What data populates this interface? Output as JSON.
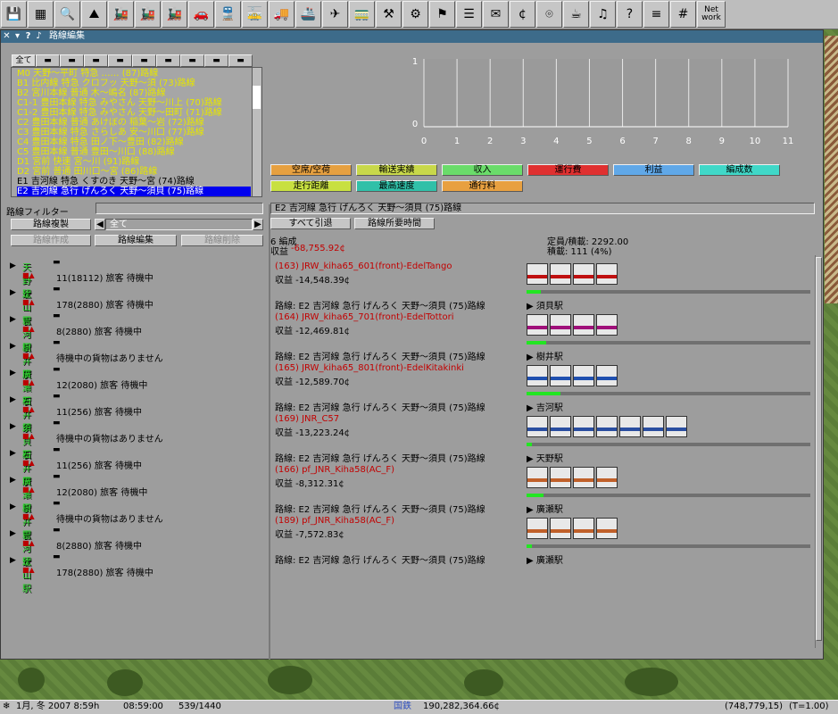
{
  "toolbar": {
    "icons": [
      "save-icon",
      "map-icon",
      "zoom-icon",
      "terrain-icon",
      "steam-loco-icon",
      "steam-loco-icon",
      "steam-loco-icon",
      "car-icon",
      "train-icon",
      "tram-icon",
      "truck-icon",
      "ship-icon",
      "plane-icon",
      "loco-icon",
      "crane-icon",
      "tools-icon",
      "signal-icon",
      "list-icon",
      "mailbox-icon",
      "money-icon",
      "camera-icon",
      "cup-icon",
      "music-icon",
      "help-icon",
      "rail-icon",
      "grid-icon"
    ],
    "network_label_1": "Net",
    "network_label_2": "work"
  },
  "window": {
    "title": "路線編集",
    "close": "✕",
    "menu": "▾",
    "help": "?",
    "pin": "♪"
  },
  "tabs": [
    "全て",
    "",
    "",
    "",
    "",
    "",
    "",
    "",
    "",
    ""
  ],
  "lines": [
    {
      "text": "M0  天野～平町  特急  ……  (87)路線",
      "style": "y"
    },
    {
      "text": "B1  比内線  特急  クロフッ  天野～須  (73)路線",
      "style": "y"
    },
    {
      "text": "B2  宮川本線  普通  木～嶋名  (87)路線",
      "style": "y"
    },
    {
      "text": "C1-1  豊田本線  特急  みやさん  天野～川上  (70)路線",
      "style": "y"
    },
    {
      "text": "C1-2  豊田本線  特急  みやさん  天野～田町  (71)路線",
      "style": "y"
    },
    {
      "text": "C2  豊田本線  普通  あけぼの  稲葉～岩  (72)路線",
      "style": "y"
    },
    {
      "text": "C3  豊田本線  特急  さらしあ  安～川口  (77)路線",
      "style": "y"
    },
    {
      "text": "C4  豊田本線  特急  田ノ下～豊田  (82)路線",
      "style": "y"
    },
    {
      "text": "C5  豊田本線  普通  豊田～川口  (88)路線",
      "style": "y"
    },
    {
      "text": "D1  宮前  快速  宮～川  (91)路線",
      "style": "y"
    },
    {
      "text": "D2  宮前  普通  田川口～宮  (86)路線",
      "style": "y"
    },
    {
      "text": "E1  吉河線  特急  くすのき  天野～宮  (74)路線",
      "style": "bl"
    },
    {
      "text": "E2  吉河線  急行  げんろく  天野～須貝  (75)路線",
      "style": "sel"
    }
  ],
  "filter": {
    "label": "路線フィルター",
    "copy_button": "路線複製",
    "filter_value": "全て",
    "create_button": "路線作成",
    "edit_button": "路線編集",
    "delete_button": "路線削除"
  },
  "stations": [
    {
      "name": "天野駅",
      "info": "11(18112) 旅客 待機中"
    },
    {
      "name": "辻山駅",
      "info": "178(2880) 旅客 待機中"
    },
    {
      "name": "吉河駅",
      "info": "8(2880) 旅客 待機中"
    },
    {
      "name": "樹井駅",
      "info": "待機中の貨物はありません"
    },
    {
      "name": "廣瀬駅",
      "info": "12(2080) 旅客 待機中"
    },
    {
      "name": "石井駅",
      "info": "11(256) 旅客 待機中"
    },
    {
      "name": "須貝駅",
      "info": "待機中の貨物はありません"
    },
    {
      "name": "石井駅",
      "info": "11(256) 旅客 待機中"
    },
    {
      "name": "廣瀬駅",
      "info": "12(2080) 旅客 待機中"
    },
    {
      "name": "樹井駅",
      "info": "待機中の貨物はありません"
    },
    {
      "name": "吉河駅",
      "info": "8(2880) 旅客 待機中"
    },
    {
      "name": "辻山駅",
      "info": "178(2880) 旅客 待機中"
    }
  ],
  "chart_data": {
    "type": "line",
    "x": [
      0,
      1,
      2,
      3,
      4,
      5,
      6,
      7,
      8,
      9,
      10,
      11
    ],
    "ylim": [
      0,
      1
    ],
    "y_ticks": [
      "0",
      "1"
    ],
    "grid": true,
    "series": []
  },
  "chart_buttons": [
    {
      "label": "空席/空荷",
      "color": "#e6a040"
    },
    {
      "label": "輸送実績",
      "color": "#c8d84a"
    },
    {
      "label": "収入",
      "color": "#6adc6a"
    },
    {
      "label": "運行費",
      "color": "#e03030"
    },
    {
      "label": "利益",
      "color": "#60a8e8"
    },
    {
      "label": "編成数",
      "color": "#40d8c8"
    },
    {
      "label": "走行距離",
      "color": "#c8e040"
    },
    {
      "label": "最高速度",
      "color": "#30c0a8"
    },
    {
      "label": "通行料",
      "color": "#e8a040"
    }
  ],
  "selected_line": {
    "name": "E2  吉河線  急行  げんろく  天野～須貝  (75)路線",
    "withdraw_button": "すべて引退",
    "time_button": "路線所要時間",
    "convoy_count": "6 編成",
    "income_label": "収益",
    "income": "-68,755.92¢",
    "capacity": "定員/積載: 2292.00",
    "load": "積載: 111 (4%)"
  },
  "convoys": [
    {
      "name": "(163) JRW_kiha65_601(front)-EdelTango",
      "income": "収益 -14,548.39¢",
      "route": "路線: E2  吉河線  急行  げんろく  天野～須貝  (75)路線",
      "dest": "須貝駅",
      "fill": 0.05,
      "livery": "#c01010"
    },
    {
      "name": "(164) JRW_kiha65_701(front)-EdelTottori",
      "income": "収益 -12,469.81¢",
      "route": "路線: E2  吉河線  急行  げんろく  天野～須貝  (75)路線",
      "dest": "樹井駅",
      "fill": 0.07,
      "livery": "#a0107a"
    },
    {
      "name": "(165) JRW_kiha65_801(front)-EdelKitakinki",
      "income": "収益 -12,589.70¢",
      "route": "路線: E2  吉河線  急行  げんろく  天野～須貝  (75)路線",
      "dest": "吉河駅",
      "fill": 0.12,
      "livery": "#2050b0"
    },
    {
      "name": "(169) JNR_C57",
      "income": "収益 -13,223.24¢",
      "route": "路線: E2  吉河線  急行  げんろく  天野～須貝  (75)路線",
      "dest": "天野駅",
      "fill": 0.0,
      "livery": "#2a4ea0"
    },
    {
      "name": "(166) pf_JNR_Kiha58(AC_F)",
      "income": "収益 -8,312.31¢",
      "route": "路線: E2  吉河線  急行  げんろく  天野～須貝  (75)路線",
      "dest": "廣瀬駅",
      "fill": 0.06,
      "livery": "#c0602a"
    },
    {
      "name": "(189) pf_JNR_Kiha58(AC_F)",
      "income": "収益 -7,572.83¢",
      "route": "路線: E2  吉河線  急行  げんろく  天野～須貝  (75)路線",
      "dest": "廣瀬駅",
      "fill": 0.0,
      "livery": "#c0602a"
    }
  ],
  "status": {
    "date": "1月, 冬 2007  8:59h",
    "time": "08:59:00",
    "count": "539/1440",
    "company": "国鉄",
    "funds": "190,282,364.66¢",
    "coords": "(748,779,15)",
    "speed": "(T=1.00)"
  }
}
